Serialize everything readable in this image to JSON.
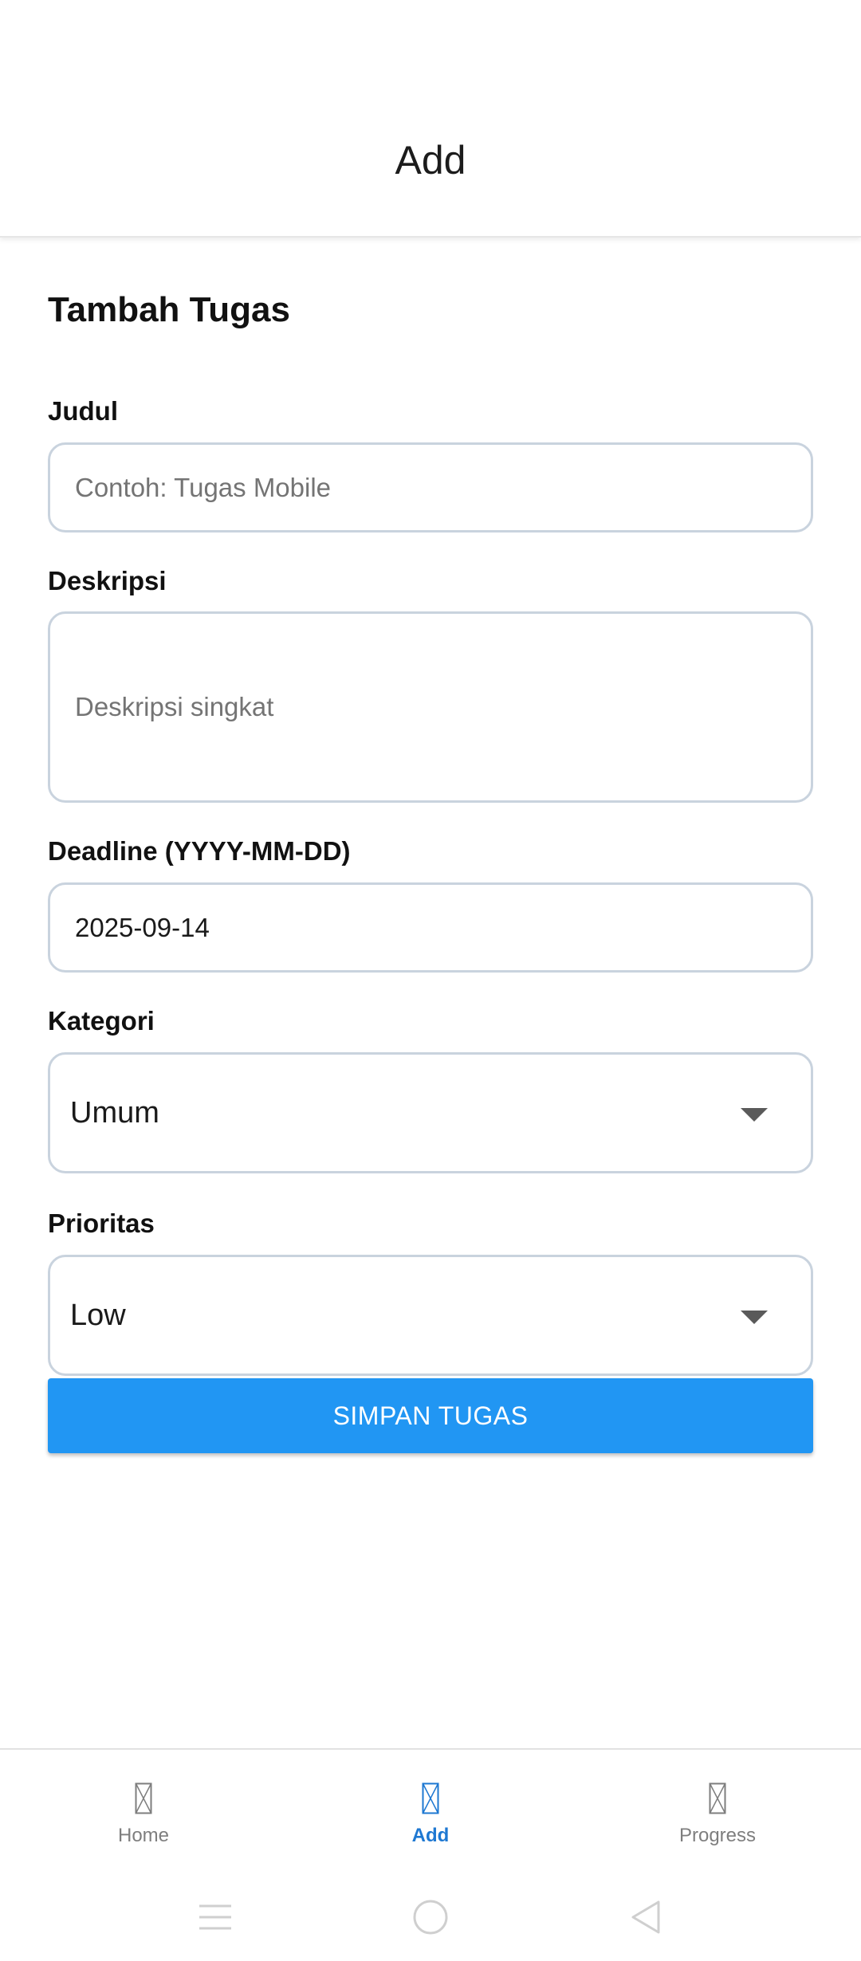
{
  "header": {
    "title": "Add"
  },
  "form": {
    "title": "Tambah Tugas",
    "judul": {
      "label": "Judul",
      "placeholder": "Contoh: Tugas Mobile"
    },
    "deskripsi": {
      "label": "Deskripsi",
      "placeholder": "Deskripsi singkat"
    },
    "deadline": {
      "label": "Deadline (YYYY-MM-DD)",
      "value": "2025-09-14"
    },
    "kategori": {
      "label": "Kategori",
      "selected": "Umum"
    },
    "prioritas": {
      "label": "Prioritas",
      "selected": "Low"
    },
    "save_label": "SIMPAN TUGAS"
  },
  "nav": {
    "items": [
      {
        "label": "Home",
        "icon": "missing-glyph-icon",
        "active": false
      },
      {
        "label": "Add",
        "icon": "missing-glyph-icon",
        "active": true
      },
      {
        "label": "Progress",
        "icon": "missing-glyph-icon",
        "active": false
      }
    ]
  },
  "colors": {
    "accent": "#2196f3",
    "nav_active": "#1e78d2",
    "nav_inactive": "#7e7e7e",
    "field_border": "#c9d3de"
  }
}
